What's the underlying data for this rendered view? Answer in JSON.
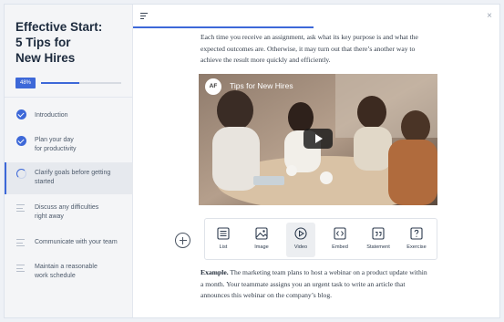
{
  "course": {
    "title_line1": "Effective Start:",
    "title_line2": "5 Tips for",
    "title_line3": "New Hires",
    "progress_label": "48%",
    "progress_fraction": 0.48
  },
  "lessons": [
    {
      "line1": "Introduction",
      "line2": "",
      "status": "completed"
    },
    {
      "line1": "Plan your day",
      "line2": "for productivity",
      "status": "completed"
    },
    {
      "line1": "Clarify goals before getting",
      "line2": "started",
      "status": "in-progress"
    },
    {
      "line1": "Discuss any difficulties",
      "line2": "right away",
      "status": "not-started"
    },
    {
      "line1": "Communicate with your team",
      "line2": "",
      "status": "not-started"
    },
    {
      "line1": "Maintain a reasonable",
      "line2": "work schedule",
      "status": "not-started"
    }
  ],
  "header": {
    "close_glyph": "×",
    "menu_icon": "outline-icon"
  },
  "content": {
    "intro_line1": "Each time you receive an assignment, ask what its key purpose is and what the",
    "intro_line2": "expected outcomes are. Otherwise, it may turn out that there’s another way to",
    "intro_line3": "achieve the result more quickly and efficiently.",
    "video": {
      "logo_text": "AF",
      "title": "Tips for New Hires"
    },
    "example_label": "Example.",
    "example_line1_rest": " The marketing team plans to host a webinar on a product update within",
    "example_line2": "a month. Your teammate assigns you an urgent task to write an article that",
    "example_line3": "announces this webinar on the company’s blog."
  },
  "block_menu": {
    "items": [
      {
        "label": "List",
        "icon": "list-icon"
      },
      {
        "label": "Image",
        "icon": "image-icon"
      },
      {
        "label": "Video",
        "icon": "video-icon"
      },
      {
        "label": "Embed",
        "icon": "embed-icon"
      },
      {
        "label": "Statement",
        "icon": "quote-icon"
      },
      {
        "label": "Exercise",
        "icon": "question-icon"
      }
    ],
    "selected": "Video"
  },
  "colors": {
    "accent": "#3d68d8",
    "sidebar_bg": "#f4f5f7",
    "active_lesson_bg": "#e6e9ee"
  }
}
